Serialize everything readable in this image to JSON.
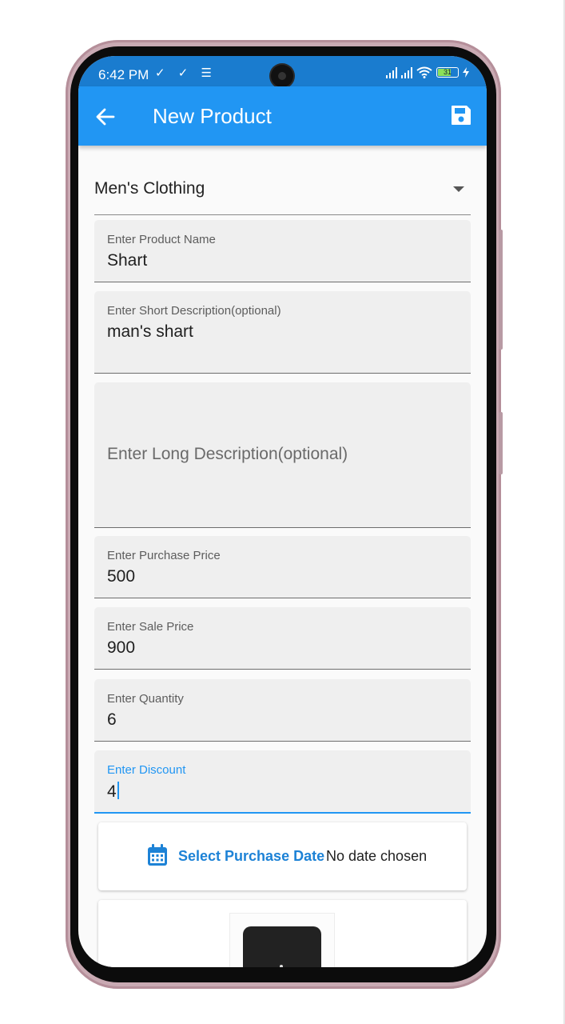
{
  "status_bar": {
    "time": "6:42 PM",
    "left_icons": "✓ ✓ ☰",
    "battery": "31"
  },
  "app_bar": {
    "title": "New Product",
    "back_icon": "arrow-left-icon",
    "save_icon": "floppy-disk-icon"
  },
  "category": {
    "selected": "Men's Clothing"
  },
  "fields": {
    "product_name": {
      "label": "Enter Product Name",
      "value": "Shart"
    },
    "short_description": {
      "label": "Enter Short Description(optional)",
      "value": "man's shart"
    },
    "long_description": {
      "placeholder": "Enter Long Description(optional)"
    },
    "purchase_price": {
      "label": "Enter Purchase Price",
      "value": "500"
    },
    "sale_price": {
      "label": "Enter Sale Price",
      "value": "900"
    },
    "quantity": {
      "label": "Enter Quantity",
      "value": "6"
    },
    "discount": {
      "label": "Enter Discount",
      "value": "4"
    }
  },
  "purchase_date": {
    "button_label": "Select Purchase Date",
    "value": "No date chosen",
    "icon": "calendar-icon"
  },
  "colors": {
    "app_bar": "#2196f3",
    "status_bar": "#1a7ccf",
    "accent": "#2196f3"
  }
}
